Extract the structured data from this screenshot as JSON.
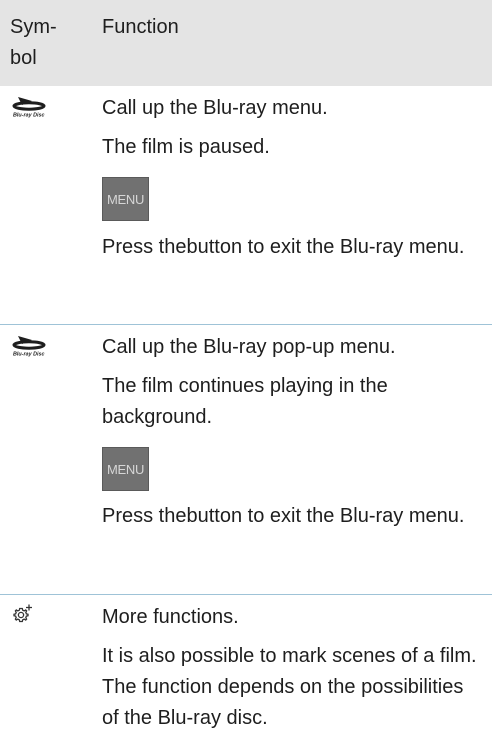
{
  "header": {
    "symbol_label": "Sym-\nbol",
    "function_label": "Function"
  },
  "rows": [
    {
      "icon": "blu-ray-disc-icon",
      "paragraphs": [
        "Call up the Blu-ray menu.",
        "The film is paused."
      ],
      "button_label": "MENU",
      "after": "Press thebutton to exit the Blu-ray menu."
    },
    {
      "icon": "blu-ray-disc-icon",
      "paragraphs": [
        "Call up the Blu-ray pop-up menu.",
        "The film continues playing in the background."
      ],
      "button_label": "MENU",
      "after": "Press thebutton to exit the Blu-ray menu."
    },
    {
      "icon": "gear-plus-icon",
      "paragraphs": [
        "More functions.",
        "It is also possible to mark scenes of a film. The function depends on the possibilities of the Blu-ray disc."
      ]
    }
  ],
  "colors": {
    "header_bg": "#e4e4e4",
    "row_divider": "#9fc3d7",
    "menu_button_bg": "#717171",
    "menu_button_text": "#d6d6d6"
  }
}
